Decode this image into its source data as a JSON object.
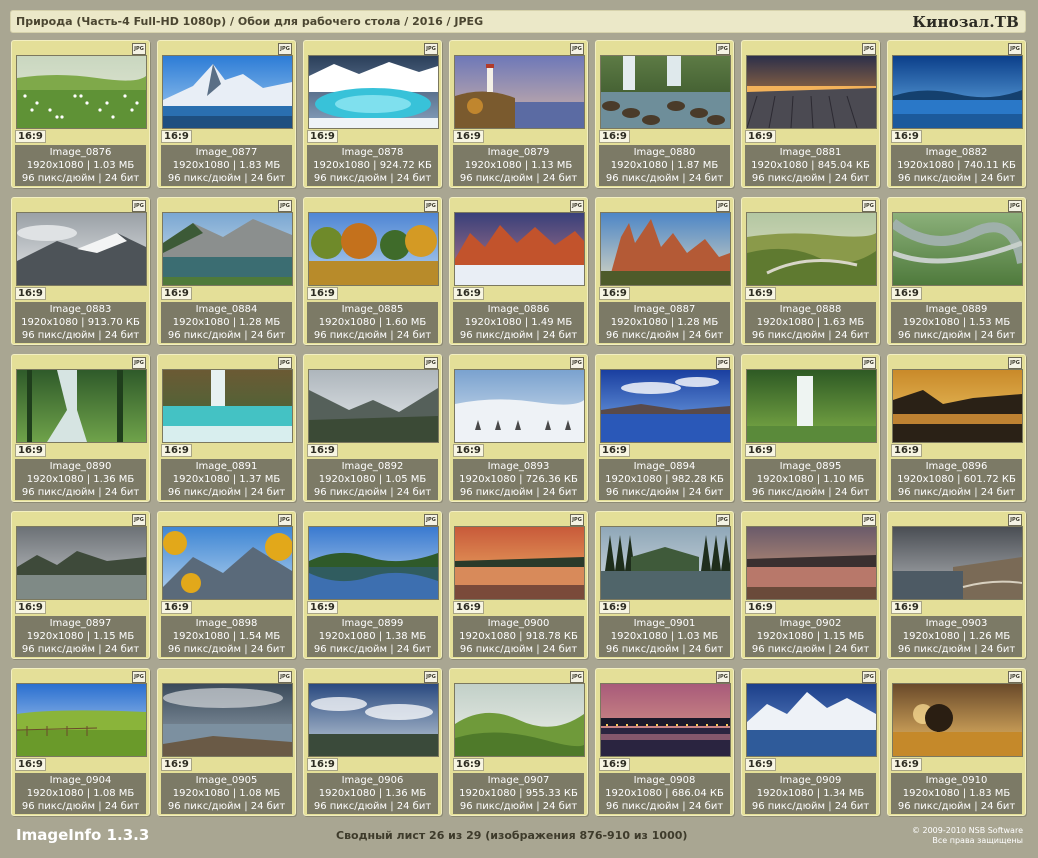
{
  "header": {
    "path": "Природа (Часть-4 Full-HD 1080p) / Обои для рабочего стола / 2016 / JPEG",
    "brand": "Кинозал.ТВ"
  },
  "tiles": [
    {
      "name": "Image_0876",
      "dims": "1920x1080 | 1.03 МБ",
      "meta": "96 пикс/дюйм | 24 бит",
      "ratio": "16:9",
      "fmt": "JPG",
      "scene": "meadow"
    },
    {
      "name": "Image_0877",
      "dims": "1920x1080 | 1.83 МБ",
      "meta": "96 пикс/дюйм | 24 бит",
      "ratio": "16:9",
      "fmt": "JPG",
      "scene": "alpine"
    },
    {
      "name": "Image_0878",
      "dims": "1920x1080 | 924.72 КБ",
      "meta": "96 пикс/дюйм | 24 бит",
      "ratio": "16:9",
      "fmt": "JPG",
      "scene": "iceLake"
    },
    {
      "name": "Image_0879",
      "dims": "1920x1080 | 1.13 МБ",
      "meta": "96 пикс/дюйм | 24 бит",
      "ratio": "16:9",
      "fmt": "JPG",
      "scene": "lighthouse"
    },
    {
      "name": "Image_0880",
      "dims": "1920x1080 | 1.87 МБ",
      "meta": "96 пикс/дюйм | 24 бит",
      "ratio": "16:9",
      "fmt": "JPG",
      "scene": "waterfall"
    },
    {
      "name": "Image_0881",
      "dims": "1920x1080 | 845.04 КБ",
      "meta": "96 пикс/дюйм | 24 бит",
      "ratio": "16:9",
      "fmt": "JPG",
      "scene": "sunsetRocks"
    },
    {
      "name": "Image_0882",
      "dims": "1920x1080 | 740.11 КБ",
      "meta": "96 пикс/дюйм | 24 бит",
      "ratio": "16:9",
      "fmt": "JPG",
      "scene": "blueLake"
    },
    {
      "name": "Image_0883",
      "dims": "1920x1080 | 913.70 КБ",
      "meta": "96 пикс/дюйм | 24 бит",
      "ratio": "16:9",
      "fmt": "JPG",
      "scene": "cloudyMountain"
    },
    {
      "name": "Image_0884",
      "dims": "1920x1080 | 1.28 МБ",
      "meta": "96 пикс/дюйм | 24 бит",
      "ratio": "16:9",
      "fmt": "JPG",
      "scene": "mountainLake"
    },
    {
      "name": "Image_0885",
      "dims": "1920x1080 | 1.60 МБ",
      "meta": "96 пикс/дюйм | 24 бит",
      "ratio": "16:9",
      "fmt": "JPG",
      "scene": "autumnTrees"
    },
    {
      "name": "Image_0886",
      "dims": "1920x1080 | 1.49 МБ",
      "meta": "96 пикс/дюйм | 24 бит",
      "ratio": "16:9",
      "fmt": "JPG",
      "scene": "redPeaks"
    },
    {
      "name": "Image_0887",
      "dims": "1920x1080 | 1.28 МБ",
      "meta": "96 пикс/дюйм | 24 бит",
      "ratio": "16:9",
      "fmt": "JPG",
      "scene": "redRocks"
    },
    {
      "name": "Image_0888",
      "dims": "1920x1080 | 1.63 МБ",
      "meta": "96 пикс/дюйм | 24 бит",
      "ratio": "16:9",
      "fmt": "JPG",
      "scene": "valley"
    },
    {
      "name": "Image_0889",
      "dims": "1920x1080 | 1.53 МБ",
      "meta": "96 пикс/дюйм | 24 бит",
      "ratio": "16:9",
      "fmt": "JPG",
      "scene": "aerialRiver"
    },
    {
      "name": "Image_0890",
      "dims": "1920x1080 | 1.36 МБ",
      "meta": "96 пикс/дюйм | 24 бит",
      "ratio": "16:9",
      "fmt": "JPG",
      "scene": "forestStream"
    },
    {
      "name": "Image_0891",
      "dims": "1920x1080 | 1.37 МБ",
      "meta": "96 пикс/дюйм | 24 бит",
      "ratio": "16:9",
      "fmt": "JPG",
      "scene": "turquoiseFalls"
    },
    {
      "name": "Image_0892",
      "dims": "1920x1080 | 1.05 МБ",
      "meta": "96 пикс/дюйм | 24 бит",
      "ratio": "16:9",
      "fmt": "JPG",
      "scene": "greyValley"
    },
    {
      "name": "Image_0893",
      "dims": "1920x1080 | 726.36 КБ",
      "meta": "96 пикс/дюйм | 24 бит",
      "ratio": "16:9",
      "fmt": "JPG",
      "scene": "snowField"
    },
    {
      "name": "Image_0894",
      "dims": "1920x1080 | 982.28 КБ",
      "meta": "96 пикс/дюйм | 24 бит",
      "ratio": "16:9",
      "fmt": "JPG",
      "scene": "blueSkyLake"
    },
    {
      "name": "Image_0895",
      "dims": "1920x1080 | 1.10 МБ",
      "meta": "96 пикс/дюйм | 24 бит",
      "ratio": "16:9",
      "fmt": "JPG",
      "scene": "greenFalls"
    },
    {
      "name": "Image_0896",
      "dims": "1920x1080 | 601.72 КБ",
      "meta": "96 пикс/дюйм | 24 бит",
      "ratio": "16:9",
      "fmt": "JPG",
      "scene": "goldenGorge"
    },
    {
      "name": "Image_0897",
      "dims": "1920x1080 | 1.15 МБ",
      "meta": "96 пикс/дюйм | 24 бит",
      "ratio": "16:9",
      "fmt": "JPG",
      "scene": "greyRiver"
    },
    {
      "name": "Image_0898",
      "dims": "1920x1080 | 1.54 МБ",
      "meta": "96 пикс/дюйм | 24 бит",
      "ratio": "16:9",
      "fmt": "JPG",
      "scene": "autumnLeaves"
    },
    {
      "name": "Image_0899",
      "dims": "1920x1080 | 1.38 МБ",
      "meta": "96 пикс/дюйм | 24 бит",
      "ratio": "16:9",
      "fmt": "JPG",
      "scene": "reflectionLake"
    },
    {
      "name": "Image_0900",
      "dims": "1920x1080 | 918.78 КБ",
      "meta": "96 пикс/дюйм | 24 бит",
      "ratio": "16:9",
      "fmt": "JPG",
      "scene": "sunsetWater"
    },
    {
      "name": "Image_0901",
      "dims": "1920x1080 | 1.03 МБ",
      "meta": "96 пикс/дюйм | 24 бит",
      "ratio": "16:9",
      "fmt": "JPG",
      "scene": "darkForestLake"
    },
    {
      "name": "Image_0902",
      "dims": "1920x1080 | 1.15 МБ",
      "meta": "96 пикс/дюйм | 24 бит",
      "ratio": "16:9",
      "fmt": "JPG",
      "scene": "duskLake"
    },
    {
      "name": "Image_0903",
      "dims": "1920x1080 | 1.26 МБ",
      "meta": "96 пикс/дюйм | 24 бит",
      "ratio": "16:9",
      "fmt": "JPG",
      "scene": "stormyCoast"
    },
    {
      "name": "Image_0904",
      "dims": "1920x1080 | 1.08 МБ",
      "meta": "96 пикс/дюйм | 24 бит",
      "ratio": "16:9",
      "fmt": "JPG",
      "scene": "greenField"
    },
    {
      "name": "Image_0905",
      "dims": "1920x1080 | 1.08 МБ",
      "meta": "96 пикс/дюйм | 24 бит",
      "ratio": "16:9",
      "fmt": "JPG",
      "scene": "cloudyShore"
    },
    {
      "name": "Image_0906",
      "dims": "1920x1080 | 1.36 МБ",
      "meta": "96 пикс/дюйм | 24 бит",
      "ratio": "16:9",
      "fmt": "JPG",
      "scene": "dramaticSky"
    },
    {
      "name": "Image_0907",
      "dims": "1920x1080 | 955.33 КБ",
      "meta": "96 пикс/дюйм | 24 бит",
      "ratio": "16:9",
      "fmt": "JPG",
      "scene": "greenHills"
    },
    {
      "name": "Image_0908",
      "dims": "1920x1080 | 686.04 КБ",
      "meta": "96 пикс/дюйм | 24 бит",
      "ratio": "16:9",
      "fmt": "JPG",
      "scene": "nightCity"
    },
    {
      "name": "Image_0909",
      "dims": "1920x1080 | 1.34 МБ",
      "meta": "96 пикс/дюйм | 24 бит",
      "ratio": "16:9",
      "fmt": "JPG",
      "scene": "snowPeaks"
    },
    {
      "name": "Image_0910",
      "dims": "1920x1080 | 1.83 МБ",
      "meta": "96 пикс/дюйм | 24 бит",
      "ratio": "16:9",
      "fmt": "JPG",
      "scene": "wheatSunset"
    }
  ],
  "footer": {
    "app": "ImageInfo 1.3.3",
    "summary": "Сводный лист 26 из 29 (изображения 876-910 из 1000)",
    "copyright": "© 2009-2010 NSB Software",
    "rights": "Все права защищены"
  }
}
